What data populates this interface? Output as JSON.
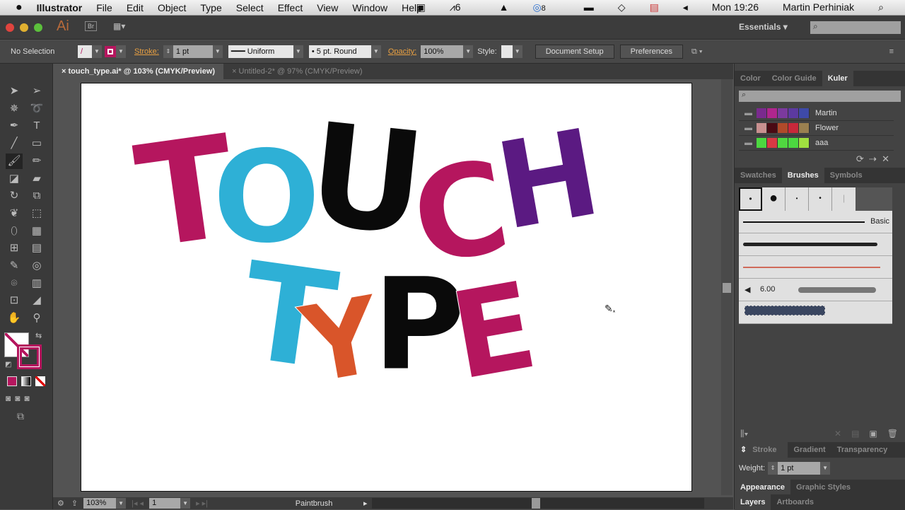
{
  "menubar": {
    "apple": "",
    "app": "Illustrator",
    "items": [
      "File",
      "Edit",
      "Object",
      "Type",
      "Select",
      "Effect",
      "View",
      "Window",
      "Help"
    ],
    "status_badge_adobe": "6",
    "status_badge_cc": "8",
    "clock": "Mon 19:26",
    "user": "Martin Perhiniak"
  },
  "appbar": {
    "logo": "Ai",
    "bridge": "Br",
    "workspace": "Essentials",
    "search_placeholder": ""
  },
  "control": {
    "selection": "No Selection",
    "stroke_label": "Stroke:",
    "stroke_value": "1 pt",
    "profile": "Uniform",
    "brush": "5 pt. Round",
    "opacity_label": "Opacity:",
    "opacity_value": "100%",
    "style_label": "Style:",
    "document_setup": "Document Setup",
    "preferences": "Preferences"
  },
  "doc_tabs": [
    {
      "label": "touch_type.ai* @ 103% (CMYK/Preview)"
    },
    {
      "label": "Untitled-2* @ 97% (CMYK/Preview)"
    }
  ],
  "artwork": {
    "letters": [
      {
        "char": "T",
        "color": "#b5165e"
      },
      {
        "char": "O",
        "color": "#2eb0d6"
      },
      {
        "char": "U",
        "color": "#0a0a0a"
      },
      {
        "char": "C",
        "color": "#b5165e"
      },
      {
        "char": "H",
        "color": "#5b1a82"
      },
      {
        "char": "T",
        "color": "#2eb0d6"
      },
      {
        "char": "Y",
        "color": "#d9552a"
      },
      {
        "char": "P",
        "color": "#0a0a0a"
      },
      {
        "char": "E",
        "color": "#b5165e"
      }
    ]
  },
  "status": {
    "zoom": "103%",
    "artboard": "1",
    "tool": "Paintbrush"
  },
  "color_panel": {
    "tabs": [
      "Color",
      "Color Guide",
      "Kuler"
    ],
    "themes": [
      {
        "name": "Martin",
        "colors": [
          "#7a2a8e",
          "#b0268e",
          "#7b3a9e",
          "#5c3aa0",
          "#3e4aa8"
        ]
      },
      {
        "name": "Flower",
        "colors": [
          "#c99090",
          "#4a0a14",
          "#b04a2a",
          "#c8283a",
          "#9a8050"
        ]
      },
      {
        "name": "aaa",
        "colors": [
          "#4cd840",
          "#d83a44",
          "#50d840",
          "#4cd840",
          "#a0e040"
        ]
      }
    ]
  },
  "brushes_panel": {
    "tabs": [
      "Swatches",
      "Brushes",
      "Symbols"
    ],
    "basic_label": "Basic",
    "bristle_value": "6.00"
  },
  "stroke_panel": {
    "tabs": [
      "Stroke",
      "Gradient",
      "Transparency"
    ],
    "weight_label": "Weight:",
    "weight_value": "1 pt"
  },
  "appearance_panel": {
    "tabs": [
      "Appearance",
      "Graphic Styles"
    ]
  },
  "layers_panel": {
    "tabs": [
      "Layers",
      "Artboards"
    ]
  }
}
